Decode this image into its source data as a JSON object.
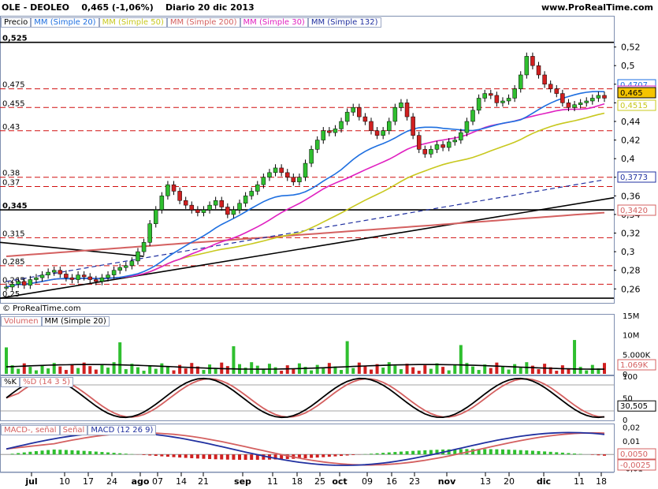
{
  "header": {
    "instrument": "OLE - DEOLEO",
    "last": "0,465 (-1,06%)",
    "period_date": "Diario  20 dic 2013",
    "site": "www.ProRealTime.com"
  },
  "price_panel": {
    "legend": [
      {
        "label": "Precio",
        "color": "#000000"
      },
      {
        "label": "MM (Simple 20)",
        "color": "#1e6fe0"
      },
      {
        "label": "MM (Simple 50)",
        "color": "#c8c81e"
      },
      {
        "label": "MM (Simple 200)",
        "color": "#d46060"
      },
      {
        "label": "MM (Simple 30)",
        "color": "#e020c0"
      },
      {
        "label": "MM (Simple 132)",
        "color": "#2030a0"
      }
    ],
    "copyright": "© ProRealTime.com",
    "level_labels": [
      "0,525",
      "0,475",
      "0,455",
      "0,43",
      "0,38",
      "0,37",
      "0,345",
      "0,315",
      "0,285",
      "0,265",
      "0,25"
    ],
    "value_badges": [
      {
        "text": "0,4707",
        "color": "#1e6fe0"
      },
      {
        "text": "0,462",
        "color": "#e020c0"
      },
      {
        "text": "0,465",
        "color": "#000000",
        "bg": "#f5c400"
      },
      {
        "text": "0,4515",
        "color": "#c8c81e"
      },
      {
        "text": "0,3773",
        "color": "#2030a0"
      },
      {
        "text": "0,3420",
        "color": "#d46060"
      }
    ]
  },
  "volume_panel": {
    "legend": [
      {
        "label": "Volumen",
        "color": "#d46060"
      },
      {
        "label": "MM (Simple 20)",
        "color": "#000000"
      }
    ],
    "axis_labels": [
      "15M",
      "10M",
      "5.000K",
      "0"
    ],
    "value_badge": "1.069K"
  },
  "stoch_panel": {
    "legend": [
      {
        "label": "%K",
        "color": "#000000"
      },
      {
        "label": "%D (14 3 5)",
        "color": "#d46060"
      }
    ],
    "axis_labels": [
      "100",
      "50",
      "0"
    ],
    "value_badge": "30,505"
  },
  "macd_panel": {
    "legend": [
      {
        "label": "MACD-, señal",
        "color": "#d46060"
      },
      {
        "label": "Señal",
        "color": "#d46060"
      },
      {
        "label": "MACD (12 26 9)",
        "color": "#2030a0"
      }
    ],
    "axis_labels": [
      "0,02",
      "0,01",
      "0",
      "-0,01"
    ],
    "value_badges": [
      {
        "text": "0,0050",
        "color": "#d46060"
      },
      {
        "text": "-0,0025",
        "color": "#d46060"
      }
    ]
  },
  "chart_data": {
    "type": "candlestick",
    "title": "OLE - DEOLEO",
    "x_ticks": [
      "jul",
      "10",
      "17",
      "24",
      "ago",
      "07",
      "14",
      "21",
      "sep",
      "11",
      "18",
      "25",
      "oct",
      "09",
      "16",
      "23",
      "nov",
      "13",
      "20",
      "dic",
      "11",
      "18"
    ],
    "y_ticks": [
      "0,52",
      "0,5",
      "0,48",
      "0,46",
      "0,44",
      "0,42",
      "0,4",
      "0,38",
      "0,36",
      "0,34",
      "0,32",
      "0,3",
      "0,28",
      "0,26"
    ],
    "ylim": [
      0.245,
      0.54
    ],
    "horizontal_levels": [
      0.525,
      0.475,
      0.455,
      0.43,
      0.38,
      0.37,
      0.345,
      0.315,
      0.285,
      0.265,
      0.25
    ],
    "close": [
      0.262,
      0.265,
      0.268,
      0.264,
      0.27,
      0.272,
      0.275,
      0.278,
      0.28,
      0.276,
      0.272,
      0.27,
      0.275,
      0.273,
      0.27,
      0.268,
      0.272,
      0.275,
      0.28,
      0.283,
      0.285,
      0.29,
      0.3,
      0.31,
      0.33,
      0.345,
      0.36,
      0.372,
      0.365,
      0.355,
      0.35,
      0.345,
      0.342,
      0.345,
      0.35,
      0.355,
      0.348,
      0.34,
      0.345,
      0.352,
      0.36,
      0.365,
      0.372,
      0.38,
      0.385,
      0.39,
      0.385,
      0.38,
      0.375,
      0.38,
      0.395,
      0.41,
      0.42,
      0.43,
      0.428,
      0.432,
      0.44,
      0.45,
      0.455,
      0.445,
      0.44,
      0.43,
      0.425,
      0.43,
      0.44,
      0.455,
      0.46,
      0.445,
      0.425,
      0.41,
      0.405,
      0.41,
      0.415,
      0.412,
      0.418,
      0.42,
      0.428,
      0.44,
      0.452,
      0.465,
      0.47,
      0.468,
      0.46,
      0.462,
      0.465,
      0.475,
      0.49,
      0.51,
      0.5,
      0.49,
      0.48,
      0.475,
      0.47,
      0.46,
      0.455,
      0.458,
      0.46,
      0.462,
      0.465,
      0.468,
      0.465
    ],
    "sma20_last": 0.4707,
    "sma30_last": 0.462,
    "sma50_last": 0.4515,
    "sma132_last": 0.3773,
    "sma200_last": 0.342,
    "volume_last": "1.069K",
    "stoch_last": 30.505,
    "macd_last": 0.005,
    "macd_hist_last": -0.0025
  }
}
